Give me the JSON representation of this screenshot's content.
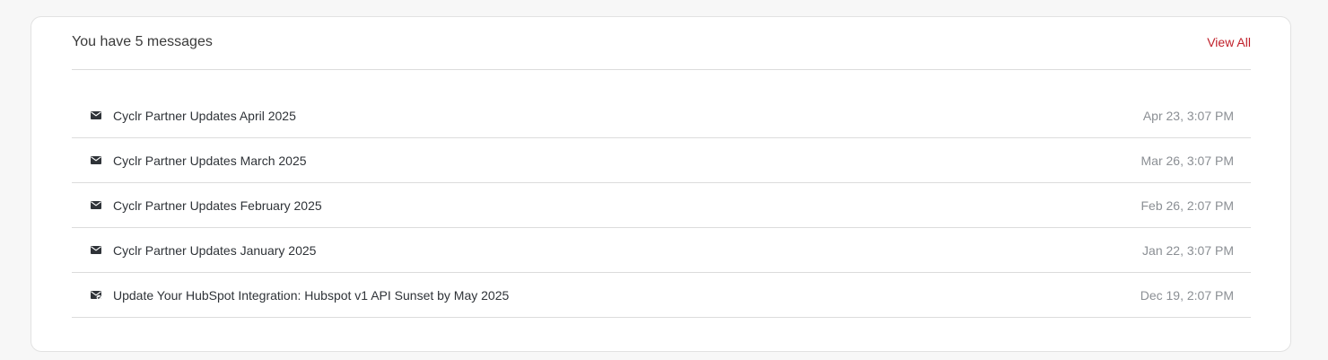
{
  "header": {
    "title": "You have 5 messages",
    "view_all_label": "View All"
  },
  "messages": [
    {
      "icon": "envelope-icon",
      "subject": "Cyclr Partner Updates April 2025",
      "time": "Apr 23, 3:07 PM"
    },
    {
      "icon": "envelope-icon",
      "subject": "Cyclr Partner Updates March 2025",
      "time": "Mar 26, 3:07 PM"
    },
    {
      "icon": "envelope-icon",
      "subject": "Cyclr Partner Updates February 2025",
      "time": "Feb 26, 2:07 PM"
    },
    {
      "icon": "envelope-icon",
      "subject": "Cyclr Partner Updates January 2025",
      "time": "Jan 22, 3:07 PM"
    },
    {
      "icon": "envelope-read-icon",
      "subject": "Update Your HubSpot Integration: Hubspot v1 API Sunset by May 2025",
      "time": "Dec 19, 2:07 PM"
    }
  ],
  "colors": {
    "accent": "#c0202a",
    "text": "#2f3338",
    "muted": "#8b8f94",
    "divider": "#dcdcdc"
  }
}
